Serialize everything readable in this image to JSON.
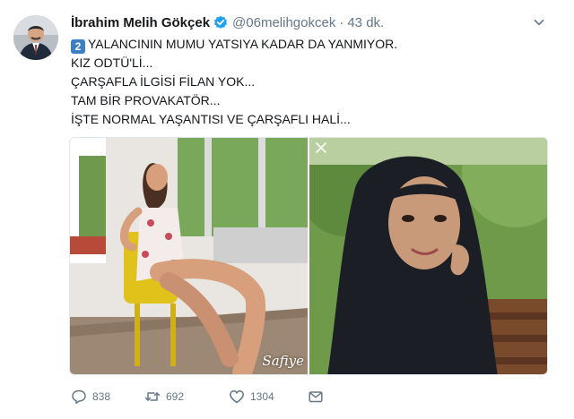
{
  "tweet": {
    "author_name": "İbrahim Melih Gökçek",
    "handle": "@06melihgokcek",
    "separator": "·",
    "time": "43 dk.",
    "keycap_number": "2",
    "lines": [
      "YALANCININ MUMU YATSIYA KADAR DA YANMIYOR.",
      "KIZ ODTÜ'Lİ...",
      "ÇARŞAFLA İLGİSİ FİLAN YOK...",
      "TAM BİR PROVAKATÖR...",
      "İŞTE NORMAL YAŞANTISI VE ÇARŞAFLI HALİ..."
    ],
    "photo_watermark": "Safiye",
    "counts": {
      "replies": "838",
      "retweets": "692",
      "likes": "1304"
    }
  },
  "colors": {
    "text": "#14171a",
    "secondary": "#657786",
    "verified": "#1da1f2",
    "keycap": "#3b7fc4"
  },
  "icons": {
    "verified": "verified-badge-icon",
    "caret": "chevron-down-icon",
    "reply": "reply-icon",
    "retweet": "retweet-icon",
    "like": "heart-icon",
    "dm": "envelope-icon"
  }
}
